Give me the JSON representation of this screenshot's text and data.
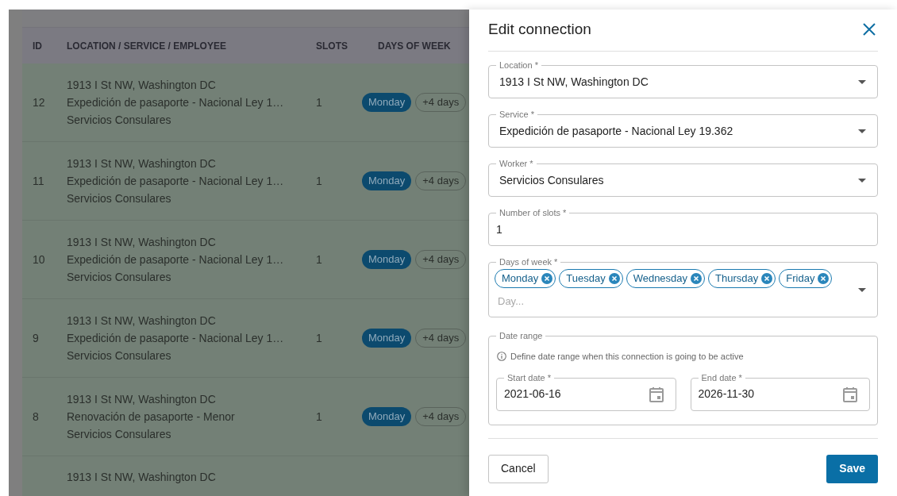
{
  "table": {
    "columns": [
      "ID",
      "LOCATION / SERVICE / EMPLOYEE",
      "SLOTS",
      "DAYS OF WEEK"
    ],
    "rows": [
      {
        "id": "12",
        "location": "1913 I St NW, Washington DC",
        "service": "Expedición de pasaporte - Nacional Ley 1…",
        "employee": "Servicios Consulares",
        "slots": "1",
        "day": "Monday",
        "more": "+4 days"
      },
      {
        "id": "11",
        "location": "1913 I St NW, Washington DC",
        "service": "Expedición de pasaporte - Nacional Ley 1…",
        "employee": "Servicios Consulares",
        "slots": "1",
        "day": "Monday",
        "more": "+4 days"
      },
      {
        "id": "10",
        "location": "1913 I St NW, Washington DC",
        "service": "Expedición de pasaporte - Nacional Ley 1…",
        "employee": "Servicios Consulares",
        "slots": "1",
        "day": "Monday",
        "more": "+4 days"
      },
      {
        "id": "9",
        "location": "1913 I St NW, Washington DC",
        "service": "Expedición de pasaporte - Nacional Ley 1…",
        "employee": "Servicios Consulares",
        "slots": "1",
        "day": "Monday",
        "more": "+4 days"
      },
      {
        "id": "8",
        "location": "1913 I St NW, Washington DC",
        "service": "Renovación de pasaporte - Menor",
        "employee": "Servicios Consulares",
        "slots": "1",
        "day": "Monday",
        "more": "+4 days"
      },
      {
        "location": "1913 I St NW, Washington DC"
      }
    ]
  },
  "drawer": {
    "title": "Edit connection",
    "fields": [
      {
        "kind": "select",
        "label": "Location *",
        "value": "1913 I St NW, Washington DC"
      },
      {
        "kind": "select",
        "label": "Service *",
        "value": "Expedición de pasaporte - Nacional Ley 19.362"
      },
      {
        "kind": "select",
        "label": "Worker *",
        "value": "Servicios Consulares"
      },
      {
        "kind": "text",
        "label": "Number of slots *",
        "value": "1"
      },
      {
        "kind": "chips",
        "label": "Days of week *",
        "chips": [
          "Monday",
          "Tuesday",
          "Wednesday",
          "Thursday",
          "Friday"
        ],
        "placeholder": "Day..."
      }
    ],
    "date_range": {
      "label": "Date range",
      "hint": "Define date range when this connection is going to be active",
      "dates": [
        {
          "label": "Start date *",
          "value": "2021-06-16"
        },
        {
          "label": "End date *",
          "value": "2026-11-30"
        }
      ]
    },
    "buttons": [
      {
        "kind": "secondary",
        "label": "Cancel"
      },
      {
        "kind": "primary",
        "label": "Save"
      }
    ]
  }
}
